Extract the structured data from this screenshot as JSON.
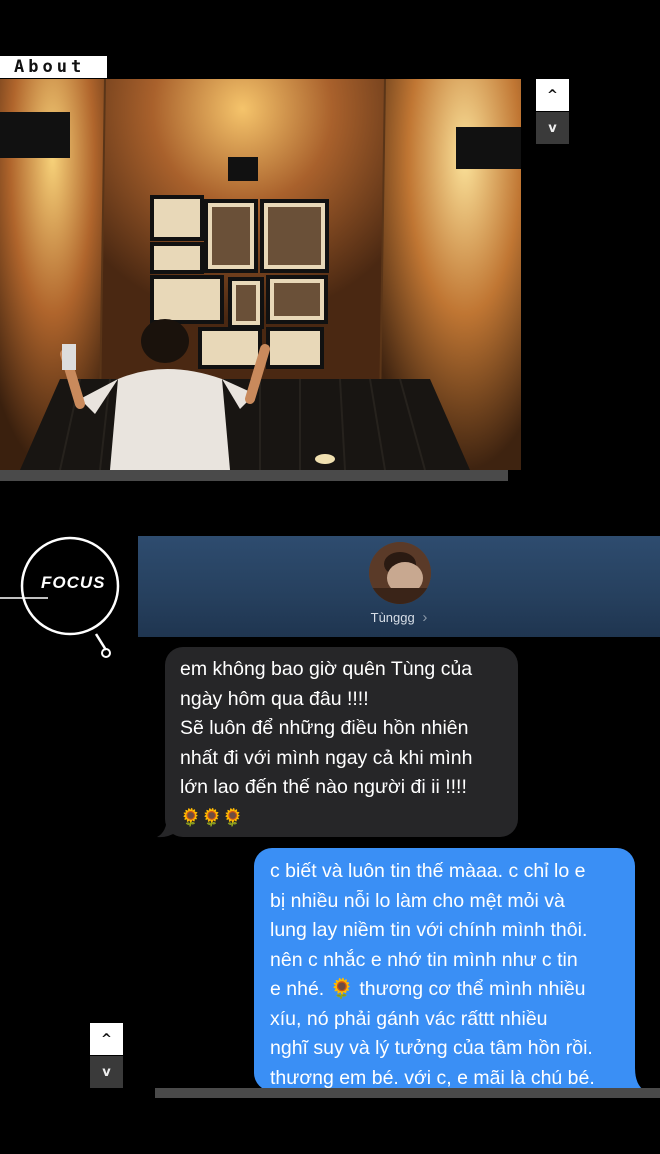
{
  "section": {
    "title": "About"
  },
  "nav_top": {
    "up": "^",
    "down": "v"
  },
  "nav_bottom": {
    "up": "^",
    "down": "v"
  },
  "focus": {
    "label": "FOCUS"
  },
  "chat": {
    "contact_name": "Tùnggg",
    "chevron": "›",
    "received": {
      "lines": [
        "em không bao giờ quên Tùng của",
        "ngày hôm qua đâu !!!!",
        "Sẽ luôn để những điều hồn nhiên",
        "nhất đi với mình ngay cả khi mình",
        "lớn lao đến thế nào người đi ii !!!!",
        "🌻🌻🌻"
      ]
    },
    "sent": {
      "lines": [
        "c biết và luôn tin thế màaa. c chỉ lo e",
        "bị nhiều nỗi lo làm cho mệt mỏi và",
        "lung lay niềm tin với chính mình thôi.",
        "nên c nhắc e nhớ tin mình như c tin",
        "e nhé. 🌻 thương cơ thể mình nhiều",
        "xíu, nó phải gánh vác rấttt nhiều",
        "nghĩ suy và lý tưởng của tâm hồn rồi.",
        "thương em bé. với c, e mãi là chú bé."
      ]
    }
  },
  "colors": {
    "background": "#000000",
    "received_bubble": "#262628",
    "sent_bubble": "#3a8ff5",
    "header": "#2e4c6f"
  }
}
